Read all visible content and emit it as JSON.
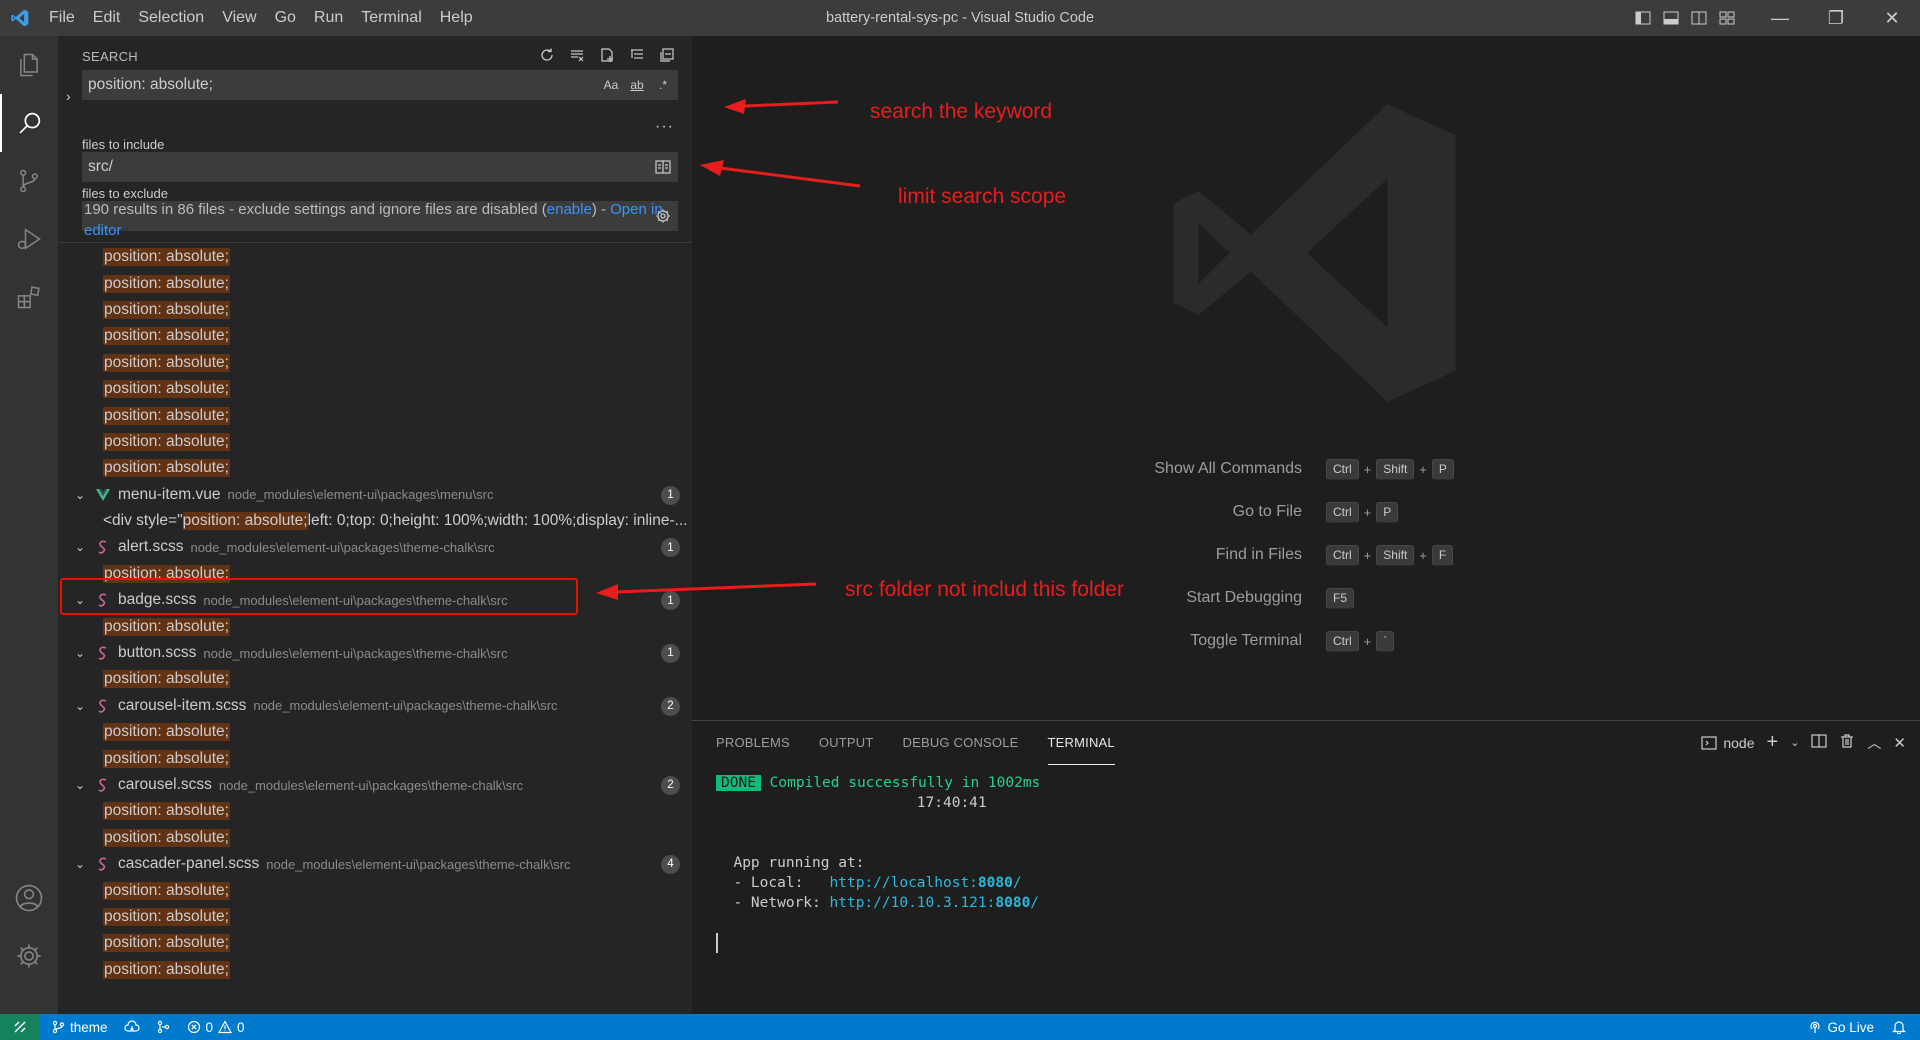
{
  "window": {
    "title": "battery-rental-sys-pc - Visual Studio Code",
    "menu": [
      "File",
      "Edit",
      "Selection",
      "View",
      "Go",
      "Run",
      "Terminal",
      "Help"
    ],
    "controls": {
      "minimize": "—",
      "restore": "❐",
      "close": "✕"
    }
  },
  "activity_bar": {
    "items": [
      "explorer-icon",
      "search-icon",
      "source-control-icon",
      "run-debug-icon",
      "extensions-icon"
    ],
    "bottom": [
      "accounts-icon",
      "manage-gear-icon"
    ],
    "active": "search-icon"
  },
  "search": {
    "header": "SEARCH",
    "query": "position: absolute;",
    "query_options": [
      "Aa",
      "ab",
      ".*"
    ],
    "more": "···",
    "include_label": "files to include",
    "include_value": "src/",
    "exclude_label": "files to exclude",
    "exclude_value": "",
    "summary_text": "190 results in 86 files - exclude settings and ignore files are disabled (",
    "summary_enable": "enable",
    "summary_sep": ") - ",
    "summary_open": "Open in editor"
  },
  "results": {
    "leading_matches": [
      "position: absolute;",
      "position: absolute;",
      "position: absolute;",
      "position: absolute;",
      "position: absolute;",
      "position: absolute;",
      "position: absolute;",
      "position: absolute;",
      "position: absolute;"
    ],
    "files": [
      {
        "name": "menu-item.vue",
        "path": "node_modules\\element-ui\\packages\\menu\\src",
        "count": "1",
        "type": "vue",
        "line_prefix": "<div style=\"",
        "line_match": "position: absolute;",
        "line_suffix": "left: 0;top: 0;height: 100%;width: 100%;display: inline-..."
      },
      {
        "name": "alert.scss",
        "path": "node_modules\\element-ui\\packages\\theme-chalk\\src",
        "count": "1",
        "type": "scss",
        "matches": [
          "position: absolute;"
        ]
      },
      {
        "name": "badge.scss",
        "path": "node_modules\\element-ui\\packages\\theme-chalk\\src",
        "count": "1",
        "type": "scss",
        "matches": [
          "position: absolute;"
        ]
      },
      {
        "name": "button.scss",
        "path": "node_modules\\element-ui\\packages\\theme-chalk\\src",
        "count": "1",
        "type": "scss",
        "matches": [
          "position: absolute;"
        ]
      },
      {
        "name": "carousel-item.scss",
        "path": "node_modules\\element-ui\\packages\\theme-chalk\\src",
        "count": "2",
        "type": "scss",
        "matches": [
          "position: absolute;",
          "position: absolute;"
        ]
      },
      {
        "name": "carousel.scss",
        "path": "node_modules\\element-ui\\packages\\theme-chalk\\src",
        "count": "2",
        "type": "scss",
        "matches": [
          "position: absolute;",
          "position: absolute;"
        ]
      },
      {
        "name": "cascader-panel.scss",
        "path": "node_modules\\element-ui\\packages\\theme-chalk\\src",
        "count": "4",
        "type": "scss",
        "matches": [
          "position: absolute;",
          "position: absolute;",
          "position: absolute;",
          "position: absolute;"
        ]
      }
    ]
  },
  "editor": {
    "shortcuts": [
      {
        "label": "Show All Commands",
        "keys": [
          "Ctrl",
          "Shift",
          "P"
        ]
      },
      {
        "label": "Go to File",
        "keys": [
          "Ctrl",
          "P"
        ]
      },
      {
        "label": "Find in Files",
        "keys": [
          "Ctrl",
          "Shift",
          "F"
        ]
      },
      {
        "label": "Start Debugging",
        "keys": [
          "F5"
        ]
      },
      {
        "label": "Toggle Terminal",
        "keys": [
          "Ctrl",
          "`"
        ]
      }
    ]
  },
  "annotations": {
    "search_keyword": "search the keyword",
    "limit_scope": "limit search scope",
    "src_folder": "src folder  not  includ this folder",
    "color": "#e81d1d"
  },
  "panel": {
    "tabs": [
      "PROBLEMS",
      "OUTPUT",
      "DEBUG CONSOLE",
      "TERMINAL"
    ],
    "active_tab": "TERMINAL",
    "terminal_name": "node",
    "terminal": {
      "done_badge": "DONE",
      "compiled": "Compiled successfully in 1002ms",
      "time": "17:40:41",
      "app_running": "App running at:",
      "local_label": "- Local:   ",
      "local_url_prefix": "http://localhost:",
      "local_port": "8080",
      "network_label": "- Network: ",
      "network_url_prefix": "http://10.10.3.121:",
      "network_port": "8080",
      "url_suffix": "/"
    }
  },
  "statusbar": {
    "branch": "theme",
    "errors": "0",
    "warnings": "0",
    "go_live": "Go Live",
    "color": "#007acc"
  }
}
